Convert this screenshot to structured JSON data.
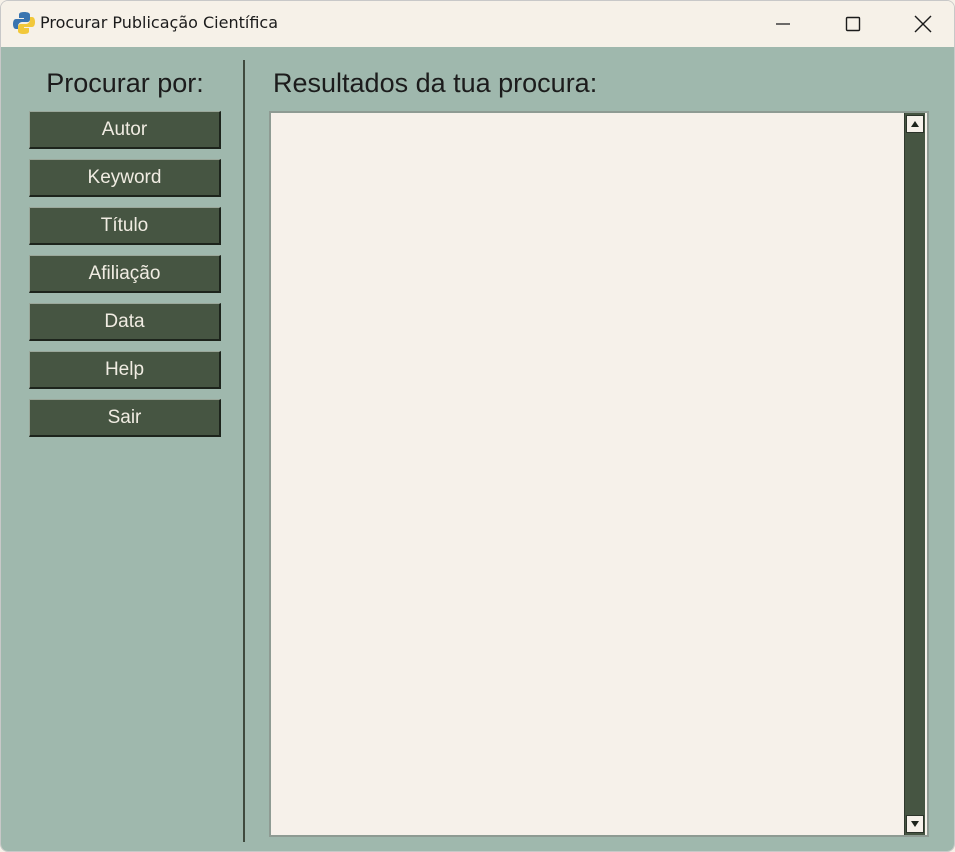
{
  "window": {
    "title": "Procurar Publicação Científica",
    "icon": "python-icon",
    "controls": [
      "minimize-icon",
      "maximize-icon",
      "close-icon"
    ]
  },
  "search_panel": {
    "heading": "Procurar por:",
    "buttons": [
      {
        "label": "Autor"
      },
      {
        "label": "Keyword"
      },
      {
        "label": "Título"
      },
      {
        "label": "Afiliação"
      },
      {
        "label": "Data"
      },
      {
        "label": "Help"
      },
      {
        "label": "Sair"
      }
    ]
  },
  "results_panel": {
    "heading": "Resultados da tua procura:",
    "content": ""
  },
  "colors": {
    "titlebar": "#f6f1e8",
    "background": "#9fb8ad",
    "button": "#465542",
    "button_text": "#f0ece2",
    "results_bg": "#f6f1ea"
  }
}
